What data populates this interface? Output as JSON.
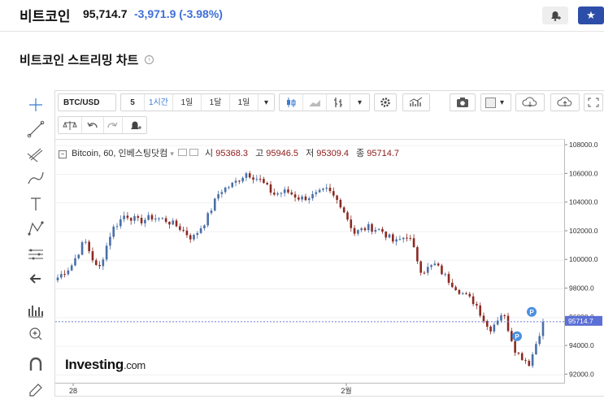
{
  "header": {
    "name": "비트코인",
    "price": "95,714.7",
    "change": "-3,971.9",
    "change_pct": "(-3.98%)",
    "accent": "#2d4ea8",
    "change_color": "#3f6fd8"
  },
  "section_title": "비트코인 스트리밍 차트",
  "toolbar": {
    "symbol": "BTC/USD",
    "intervals": [
      "5",
      "1시간",
      "1일",
      "1달",
      "1일"
    ],
    "active_interval": "1시간"
  },
  "legend": {
    "title": "Bitcoin, 60, 인베스팅닷컴",
    "open_label": "시",
    "open": "95368.3",
    "high_label": "고",
    "high": "95946.5",
    "low_label": "저",
    "low": "95309.4",
    "close_label": "종",
    "close": "95714.7"
  },
  "logo": {
    "main": "Investing",
    "suffix": ".com"
  },
  "price_tag": "95714.7",
  "markers": [
    "P",
    "P"
  ],
  "chart_data": {
    "type": "candlestick",
    "x_ticks": [
      "28",
      "2월"
    ],
    "y_ticks": [
      "108000.0",
      "106000.0",
      "104000.0",
      "102000.0",
      "100000.0",
      "98000.0",
      "96000.0",
      "94000.0",
      "92000.0"
    ],
    "ylim": [
      91400,
      108400
    ],
    "last_price": 95714.7,
    "up_color": "#4a6fa8",
    "down_color": "#8b2a22",
    "close_path": [
      98800,
      99600,
      101400,
      99200,
      102100,
      103200,
      102700,
      103000,
      102800,
      102300,
      101500,
      102800,
      104800,
      105300,
      106100,
      105600,
      104600,
      104800,
      104300,
      104500,
      104900,
      103900,
      101900,
      102300,
      102100,
      101200,
      101800,
      99200,
      99700,
      98600,
      97700,
      97000,
      95100,
      96400,
      93600,
      92800,
      95714.7
    ],
    "candle_count": 140
  },
  "tools_left": [
    "crosshair-icon",
    "trendline-icon",
    "fibonacci-icon",
    "brush-icon",
    "text-icon",
    "pattern-icon",
    "measure-icon",
    "back-arrow-icon",
    "indicator-icon",
    "zoom-icon",
    "magnet-icon",
    "lock-icon"
  ]
}
